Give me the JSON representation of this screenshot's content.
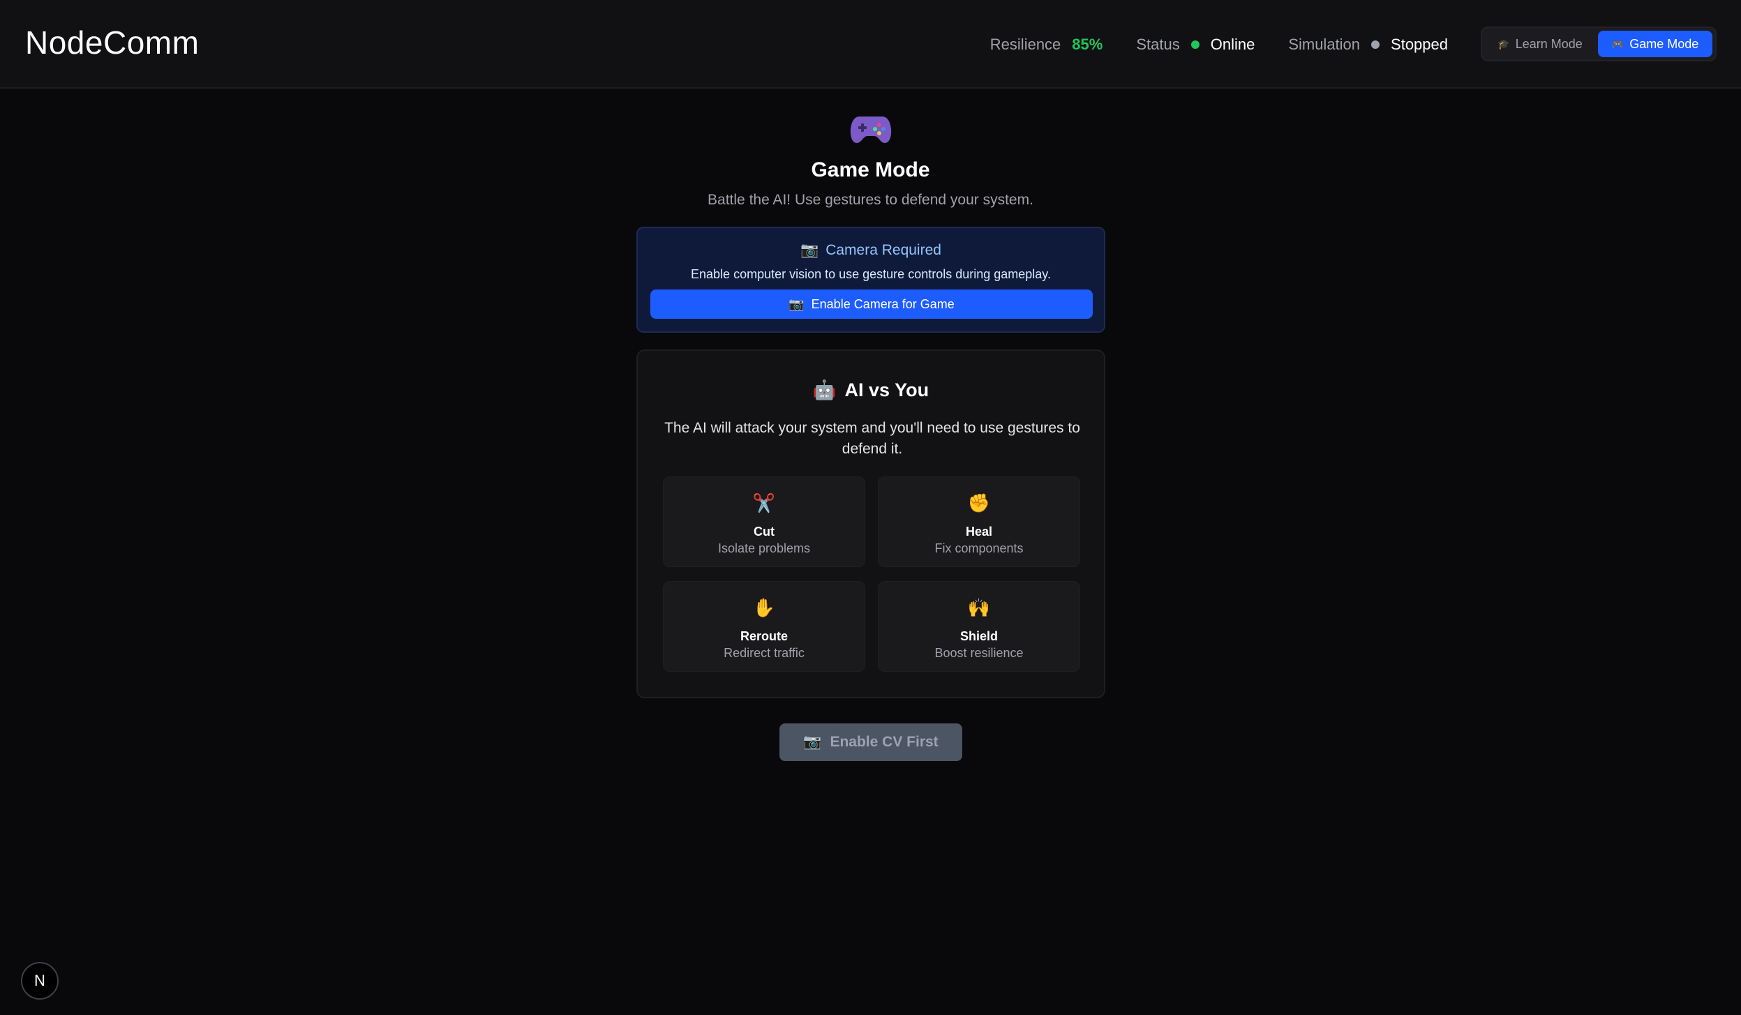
{
  "header": {
    "brand": "NodeComm",
    "stats": {
      "resilience_label": "Resilience",
      "resilience_value": "85%",
      "status_label": "Status",
      "status_value": "Online",
      "simulation_label": "Simulation",
      "simulation_value": "Stopped"
    },
    "modes": {
      "learn_label": "Learn Mode",
      "game_label": "Game Mode"
    }
  },
  "hero": {
    "icon": "gamepad-icon",
    "title": "Game Mode",
    "subtitle": "Battle the AI! Use gestures to defend your system."
  },
  "camera": {
    "title": "Camera Required",
    "subtitle": "Enable computer vision to use gesture controls during gameplay.",
    "button_label": "Enable Camera for Game"
  },
  "ai": {
    "title": "AI vs You",
    "description": "The AI will attack your system and you'll need to use gestures to defend it.",
    "gestures": [
      {
        "icon": "✂️",
        "name": "Cut",
        "desc": "Isolate problems"
      },
      {
        "icon": "✊",
        "name": "Heal",
        "desc": "Fix components"
      },
      {
        "icon": "✋",
        "name": "Reroute",
        "desc": "Redirect traffic"
      },
      {
        "icon": "🙌",
        "name": "Shield",
        "desc": "Boost resilience"
      }
    ]
  },
  "cv_button_label": "Enable CV First",
  "badge_letter": "N",
  "colors": {
    "accent": "#1d5cff",
    "online": "#22c55e",
    "background": "#09090b"
  }
}
